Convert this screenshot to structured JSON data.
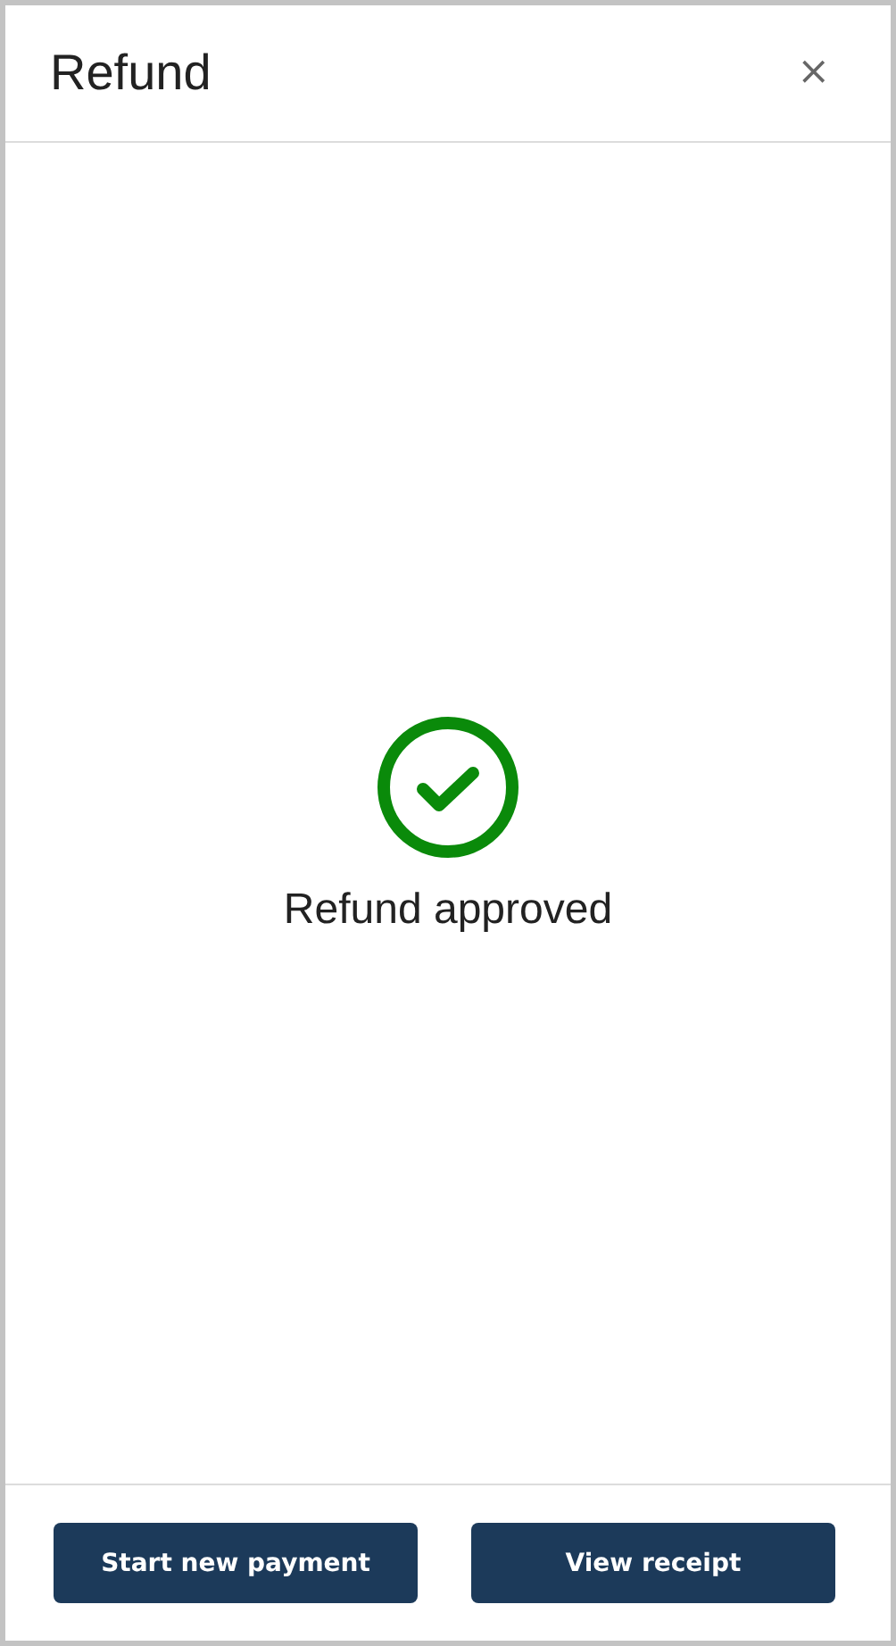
{
  "dialog": {
    "title": "Refund",
    "close": "×"
  },
  "result": {
    "kind": "success",
    "message": "Refund approved"
  },
  "buttons": [
    {
      "label": "Start new payment"
    },
    {
      "label": "View receipt"
    }
  ]
}
